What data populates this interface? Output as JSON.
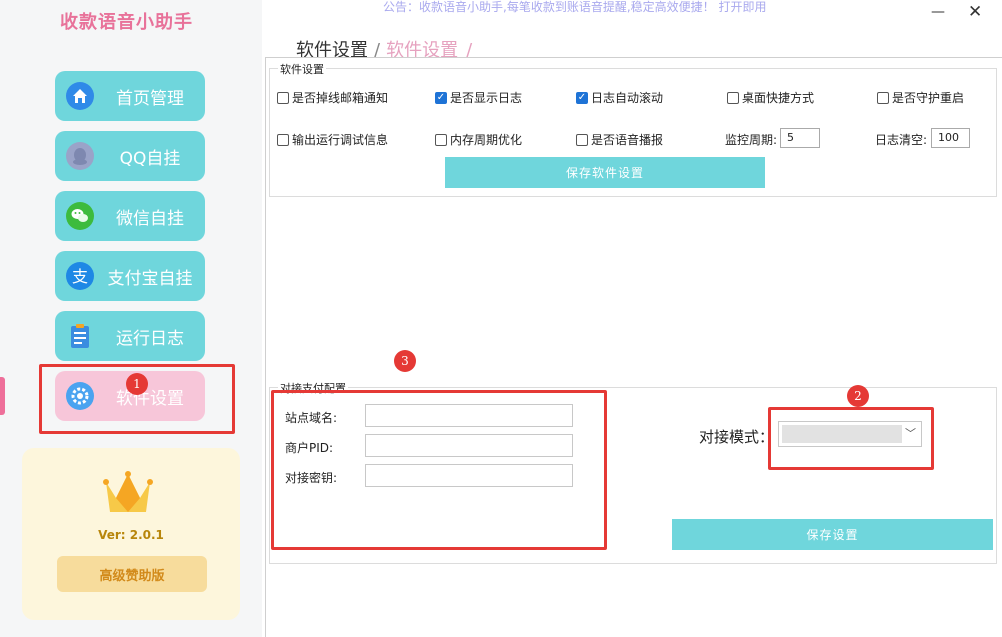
{
  "app": {
    "title": "收款语音小助手",
    "announcement": "公告：收款语音小助手,每笔收款到账语音提醒,稳定高效便捷！ 打开即用",
    "minimize_glyph": "—",
    "close_glyph": "✕"
  },
  "breadcrumb": {
    "home": "软件设置",
    "separator": "/",
    "current": "软件设置",
    "trailing_separator": "/"
  },
  "sidebar": {
    "items": [
      {
        "label": "首页管理",
        "icon": "home-icon",
        "color": "#2f8ae8"
      },
      {
        "label": "QQ自挂",
        "icon": "qq-icon",
        "color": "#9aa3c8"
      },
      {
        "label": "微信自挂",
        "icon": "wechat-icon",
        "color": "#3dbb3d"
      },
      {
        "label": "支付宝自挂",
        "icon": "alipay-icon",
        "color": "#1e88e5"
      },
      {
        "label": "运行日志",
        "icon": "log-icon",
        "color": "#3a8de0"
      },
      {
        "label": "软件设置",
        "icon": "gear-icon",
        "color": "#4aa3f0"
      }
    ],
    "version_label": "Ver:  2.0.1",
    "sponsor_button": "高级赞助版"
  },
  "software_settings": {
    "title": "软件设置",
    "checkboxes": [
      {
        "label": "是否掉线邮箱通知",
        "checked": false
      },
      {
        "label": "是否显示日志",
        "checked": true
      },
      {
        "label": "日志自动滚动",
        "checked": true
      },
      {
        "label": "桌面快捷方式",
        "checked": false
      },
      {
        "label": "是否守护重启",
        "checked": false
      },
      {
        "label": "输出运行调试信息",
        "checked": false
      },
      {
        "label": "内存周期优化",
        "checked": false
      },
      {
        "label": "是否语音播报",
        "checked": false
      }
    ],
    "monitor_period_label": "监控周期:",
    "monitor_period_value": "5",
    "log_clear_label": "日志清空:",
    "log_clear_value": "100",
    "save_button": "保存软件设置"
  },
  "payment_config": {
    "title": "对接支付配置",
    "fields": [
      {
        "label": "站点域名:",
        "value": ""
      },
      {
        "label": "商户PID:",
        "value": ""
      },
      {
        "label": "对接密钥:",
        "value": ""
      }
    ],
    "mode_label": "对接模式：",
    "mode_value": "",
    "save_button": "保存设置"
  },
  "annotations": {
    "markers": [
      "1",
      "2",
      "3"
    ],
    "color": "#e53935"
  },
  "colors": {
    "accent": "#6fd6dc",
    "title_pink": "#e8729a",
    "active_nav": "#f7c6d9"
  }
}
